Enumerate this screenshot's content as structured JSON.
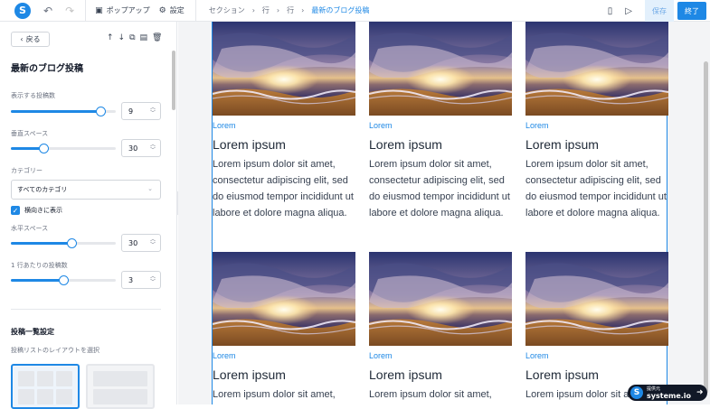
{
  "topbar": {
    "logo_letter": "S",
    "popup_label": "ポップアップ",
    "settings_label": "設定",
    "breadcrumb": [
      "セクション",
      "行",
      "行",
      "最新のブログ投稿"
    ],
    "save_label": "保存",
    "finish_label": "終了"
  },
  "sidebar": {
    "back_label": "戻る",
    "title": "最新のブログ投稿",
    "posts_count_label": "表示する投稿数",
    "posts_count_value": "9",
    "posts_count_fraction": 0.85,
    "vertical_space_label": "垂直スペース",
    "vertical_space_value": "30",
    "vertical_space_fraction": 0.31,
    "category_label": "カテゴリー",
    "category_value": "すべてのカテゴリ",
    "horizontal_label": "横向きに表示",
    "horizontal_checked": true,
    "horizontal_space_label": "水平スペース",
    "horizontal_space_value": "30",
    "horizontal_space_fraction": 0.58,
    "per_row_label": "1 行あたりの投稿数",
    "per_row_value": "3",
    "per_row_fraction": 0.5,
    "list_settings_title": "投稿一覧設定",
    "layout_select_label": "投稿リストのレイアウトを選択"
  },
  "posts": [
    {
      "category": "Lorem",
      "title": "Lorem ipsum",
      "description": "Lorem ipsum dolor sit amet, consectetur adipiscing elit, sed do eiusmod tempor incididunt ut labore et dolore magna aliqua."
    },
    {
      "category": "Lorem",
      "title": "Lorem ipsum",
      "description": "Lorem ipsum dolor sit amet, consectetur adipiscing elit, sed do eiusmod tempor incididunt ut labore et dolore magna aliqua."
    },
    {
      "category": "Lorem",
      "title": "Lorem ipsum",
      "description": "Lorem ipsum dolor sit amet, consectetur adipiscing elit, sed do eiusmod tempor incididunt ut labore et dolore magna aliqua."
    },
    {
      "category": "Lorem",
      "title": "Lorem ipsum",
      "description": "Lorem ipsum dolor sit amet,"
    },
    {
      "category": "Lorem",
      "title": "Lorem ipsum",
      "description": "Lorem ipsum dolor sit amet,"
    },
    {
      "category": "Lorem",
      "title": "Lorem ipsum",
      "description": "Lorem ipsum dolor sit amet,"
    }
  ],
  "badge": {
    "small_text": "提供元",
    "brand_text": "systeme.io"
  },
  "colors": {
    "accent": "#1e88e5",
    "save_bg": "#e3f0fc"
  }
}
